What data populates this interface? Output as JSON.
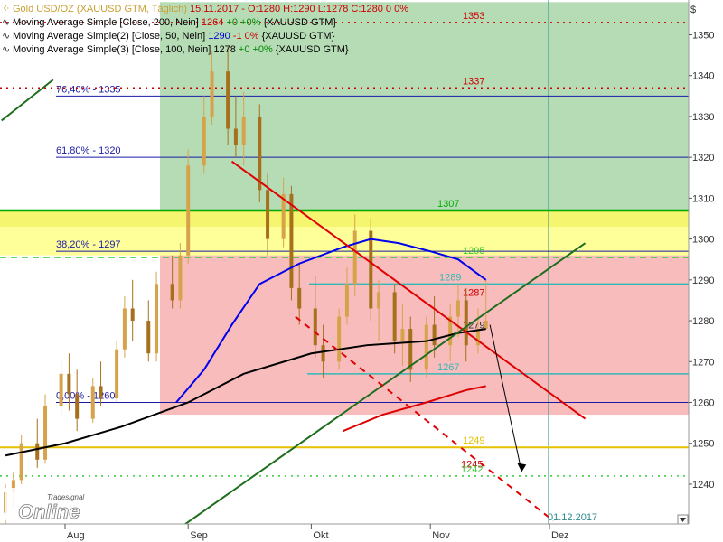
{
  "legend": {
    "row1": {
      "name": "Gold USD/OZ (XAUUSD GTM, Täglich)",
      "info": "15.11.2017 - O:1280 H:1290 L:1278",
      "close": "C:1280 0 0%"
    },
    "row2": {
      "name": "Moving Average Simple [Close, 200, Nein]",
      "value": "1264",
      "change": "+0 +0%",
      "ticker": "{XAUUSD GTM}"
    },
    "row3": {
      "name": "Moving Average Simple(2) [Close, 50, Nein]",
      "value": "1290",
      "change": "-1 0%",
      "ticker": "{XAUUSD GTM}"
    },
    "row4": {
      "name": "Moving Average Simple(3) [Close, 100, Nein]",
      "value": "1278",
      "change": "+0 +0%",
      "ticker": "{XAUUSD GTM}"
    }
  },
  "watermark": {
    "small": "Tradesignal",
    "big": "Online"
  },
  "axis_unit": "$",
  "chart_data": {
    "type": "candlestick",
    "yaxis": {
      "ticks": [
        1240,
        1250,
        1260,
        1270,
        1280,
        1290,
        1300,
        1310,
        1320,
        1330,
        1340,
        1350
      ],
      "ylim": [
        1228,
        1358
      ]
    },
    "xaxis": {
      "labels": [
        {
          "text": "Aug",
          "date": "2017-08-01"
        },
        {
          "text": "Sep",
          "date": "2017-09-01"
        },
        {
          "text": "Okt",
          "date": "2017-10-02"
        },
        {
          "text": "Nov",
          "date": "2017-11-01"
        },
        {
          "text": "Dez",
          "date": "2017-12-01"
        }
      ],
      "date_annotation": "01.12.2017"
    },
    "zones": [
      {
        "name": "green-zone",
        "from": 1307,
        "to": 1358,
        "color": "#b6dcb6"
      },
      {
        "name": "yellow-zone",
        "from": 1296,
        "to": 1307,
        "color": "#ffff99"
      },
      {
        "name": "red-zone",
        "from": 1257,
        "to": 1296,
        "color": "#f8bcbc"
      }
    ],
    "fibonacci": [
      {
        "label": "76,40% - 1335",
        "value": 1335
      },
      {
        "label": "61,80% - 1320",
        "value": 1320
      },
      {
        "label": "38,20% - 1297",
        "value": 1297
      },
      {
        "label": "0,00% - 1260",
        "value": 1260
      }
    ],
    "levels": [
      {
        "label": "1353",
        "value": 1353,
        "color": "#cc0000",
        "style": "dotted"
      },
      {
        "label": "1337",
        "value": 1337,
        "color": "#cc0000",
        "style": "dotted"
      },
      {
        "label": "1307",
        "value": 1307,
        "color": "#00aa00",
        "style": "solid"
      },
      {
        "label": "1295",
        "value": 1295.5,
        "color": "#33cc33",
        "style": "dashed"
      },
      {
        "label": "1289",
        "value": 1289,
        "color": "#33b8b8",
        "style": "solid"
      },
      {
        "label": "1287",
        "value": 1287,
        "color": "#cc0000",
        "style": "text"
      },
      {
        "label": "1279",
        "value": 1279,
        "color": "#333333",
        "style": "text"
      },
      {
        "label": "1267",
        "value": 1267,
        "color": "#33b8b8",
        "style": "solid"
      },
      {
        "label": "1249",
        "value": 1249,
        "color": "#e6c000",
        "style": "solid"
      },
      {
        "label": "1245",
        "value": 1245,
        "color": "#cc0000",
        "style": "text"
      },
      {
        "label": "1242",
        "value": 1242,
        "color": "#33cc33",
        "style": "dotted"
      }
    ],
    "series": [
      {
        "name": "MA 200",
        "color": "#dd0000",
        "points": [
          [
            "2017-10-10",
            1253
          ],
          [
            "2017-10-20",
            1257
          ],
          [
            "2017-10-31",
            1260
          ],
          [
            "2017-11-10",
            1263
          ],
          [
            "2017-11-15",
            1264
          ]
        ]
      },
      {
        "name": "MA 50",
        "color": "#0000ee",
        "points": [
          [
            "2017-08-29",
            1260
          ],
          [
            "2017-09-05",
            1268
          ],
          [
            "2017-09-12",
            1279
          ],
          [
            "2017-09-19",
            1289
          ],
          [
            "2017-09-29",
            1294
          ],
          [
            "2017-10-10",
            1298
          ],
          [
            "2017-10-17",
            1300
          ],
          [
            "2017-10-24",
            1299
          ],
          [
            "2017-11-01",
            1297
          ],
          [
            "2017-11-08",
            1295
          ],
          [
            "2017-11-15",
            1290
          ]
        ]
      },
      {
        "name": "MA 100",
        "color": "#000000",
        "points": [
          [
            "2017-07-17",
            1247
          ],
          [
            "2017-08-01",
            1250
          ],
          [
            "2017-08-15",
            1254
          ],
          [
            "2017-09-01",
            1260
          ],
          [
            "2017-09-15",
            1267
          ],
          [
            "2017-10-02",
            1272
          ],
          [
            "2017-10-16",
            1274
          ],
          [
            "2017-10-31",
            1275
          ],
          [
            "2017-11-08",
            1277
          ],
          [
            "2017-11-15",
            1278
          ]
        ]
      }
    ],
    "trendlines": [
      {
        "name": "resistance-trendline",
        "color": "#e00000",
        "dashed": false,
        "from": [
          "2017-09-12",
          1319
        ],
        "to": [
          "2017-12-10",
          1256
        ]
      },
      {
        "name": "support-trendline",
        "color": "#1e6e1e",
        "dashed": false,
        "from": [
          "2017-08-28",
          1228
        ],
        "to": [
          "2017-12-10",
          1299
        ]
      },
      {
        "name": "projected-red-trendline",
        "color": "#e00000",
        "dashed": true,
        "from": [
          "2017-09-28",
          1281
        ],
        "to": [
          "2017-12-02",
          1231
        ]
      },
      {
        "name": "upper-left-trendline",
        "color": "#1e6e1e",
        "dashed": false,
        "from": [
          "2017-07-16",
          1329
        ],
        "to": [
          "2017-07-29",
          1339
        ]
      },
      {
        "name": "projection-arrow",
        "color": "#000000",
        "dashed": false,
        "from": [
          "2017-11-16",
          1279
        ],
        "to": [
          "2017-11-24",
          1243
        ]
      }
    ],
    "candles": [
      [
        "2017-07-17",
        1233,
        1240,
        1230,
        1238
      ],
      [
        "2017-07-19",
        1238,
        1243,
        1234,
        1241
      ],
      [
        "2017-07-21",
        1241,
        1252,
        1240,
        1250
      ],
      [
        "2017-07-25",
        1250,
        1256,
        1244,
        1246
      ],
      [
        "2017-07-27",
        1246,
        1262,
        1245,
        1259
      ],
      [
        "2017-07-31",
        1259,
        1270,
        1257,
        1267
      ],
      [
        "2017-08-02",
        1267,
        1272,
        1258,
        1262
      ],
      [
        "2017-08-04",
        1262,
        1268,
        1253,
        1256
      ],
      [
        "2017-08-08",
        1256,
        1266,
        1255,
        1264
      ],
      [
        "2017-08-10",
        1264,
        1270,
        1259,
        1261
      ],
      [
        "2017-08-14",
        1261,
        1275,
        1260,
        1273
      ],
      [
        "2017-08-16",
        1273,
        1286,
        1271,
        1283
      ],
      [
        "2017-08-18",
        1283,
        1290,
        1275,
        1280
      ],
      [
        "2017-08-22",
        1280,
        1285,
        1270,
        1272
      ],
      [
        "2017-08-24",
        1272,
        1292,
        1270,
        1289
      ],
      [
        "2017-08-28",
        1289,
        1296,
        1283,
        1285
      ],
      [
        "2017-08-30",
        1285,
        1299,
        1283,
        1296
      ],
      [
        "2017-09-01",
        1296,
        1322,
        1294,
        1318
      ],
      [
        "2017-09-05",
        1318,
        1335,
        1316,
        1330
      ],
      [
        "2017-09-07",
        1330,
        1346,
        1328,
        1341
      ],
      [
        "2017-09-11",
        1341,
        1347,
        1323,
        1327
      ],
      [
        "2017-09-13",
        1327,
        1335,
        1320,
        1323
      ],
      [
        "2017-09-15",
        1323,
        1336,
        1318,
        1330
      ],
      [
        "2017-09-19",
        1330,
        1333,
        1309,
        1312
      ],
      [
        "2017-09-21",
        1312,
        1316,
        1296,
        1300
      ],
      [
        "2017-09-25",
        1300,
        1315,
        1298,
        1311
      ],
      [
        "2017-09-27",
        1311,
        1313,
        1285,
        1288
      ],
      [
        "2017-09-29",
        1288,
        1294,
        1279,
        1283
      ],
      [
        "2017-10-03",
        1283,
        1291,
        1271,
        1274
      ],
      [
        "2017-10-05",
        1274,
        1279,
        1266,
        1270
      ],
      [
        "2017-10-09",
        1270,
        1283,
        1268,
        1281
      ],
      [
        "2017-10-11",
        1281,
        1293,
        1279,
        1289
      ],
      [
        "2017-10-13",
        1289,
        1306,
        1286,
        1302
      ],
      [
        "2017-10-17",
        1302,
        1305,
        1280,
        1283
      ],
      [
        "2017-10-19",
        1283,
        1290,
        1275,
        1287
      ],
      [
        "2017-10-23",
        1287,
        1289,
        1272,
        1275
      ],
      [
        "2017-10-25",
        1275,
        1284,
        1269,
        1278
      ],
      [
        "2017-10-27",
        1278,
        1281,
        1265,
        1268
      ],
      [
        "2017-10-31",
        1268,
        1281,
        1266,
        1279
      ],
      [
        "2017-11-02",
        1279,
        1286,
        1271,
        1274
      ],
      [
        "2017-11-06",
        1274,
        1284,
        1270,
        1281
      ],
      [
        "2017-11-08",
        1281,
        1289,
        1276,
        1285
      ],
      [
        "2017-11-10",
        1285,
        1288,
        1270,
        1274
      ],
      [
        "2017-11-13",
        1274,
        1283,
        1272,
        1278
      ],
      [
        "2017-11-15",
        1278,
        1290,
        1278,
        1280
      ]
    ]
  }
}
